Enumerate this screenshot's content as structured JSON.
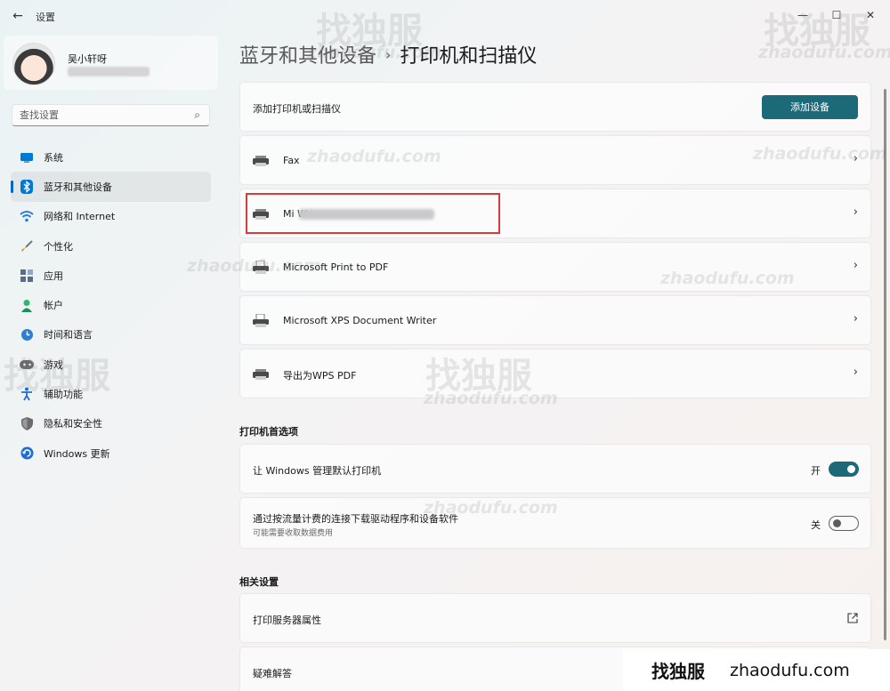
{
  "window": {
    "back_icon": "back-arrow-icon",
    "title": "设置",
    "controls": {
      "minimize": "—",
      "maximize": "☐",
      "close": "✕"
    }
  },
  "user": {
    "name": "吴小轩呀"
  },
  "search": {
    "placeholder": "查找设置",
    "icon": "search-icon"
  },
  "nav": [
    {
      "label": "系统",
      "icon": "monitor-icon",
      "color": "#0078d4"
    },
    {
      "label": "蓝牙和其他设备",
      "icon": "bluetooth-icon",
      "color": "#0078d4",
      "active": true
    },
    {
      "label": "网络和 Internet",
      "icon": "wifi-icon",
      "color": "#2d7dd2"
    },
    {
      "label": "个性化",
      "icon": "brush-icon",
      "color": "#d08a3a"
    },
    {
      "label": "应用",
      "icon": "apps-icon",
      "color": "#5b6c8a"
    },
    {
      "label": "帐户",
      "icon": "person-icon",
      "color": "#2bb673"
    },
    {
      "label": "时间和语言",
      "icon": "globe-clock-icon",
      "color": "#2d7dd2"
    },
    {
      "label": "游戏",
      "icon": "gamepad-icon",
      "color": "#6b6b6b"
    },
    {
      "label": "辅助功能",
      "icon": "accessibility-icon",
      "color": "#1f6fd1"
    },
    {
      "label": "隐私和安全性",
      "icon": "shield-icon",
      "color": "#6b6b6b"
    },
    {
      "label": "Windows 更新",
      "icon": "update-icon",
      "color": "#1f6fd1"
    }
  ],
  "breadcrumb": {
    "parent": "蓝牙和其他设备",
    "separator": "›",
    "current": "打印机和扫描仪"
  },
  "add_printer": {
    "label": "添加打印机或扫描仪",
    "button": "添加设备"
  },
  "devices": [
    {
      "name": "Fax",
      "chevron": "›"
    },
    {
      "name": "Mi W",
      "chevron": "›"
    },
    {
      "name": "Microsoft Print to PDF",
      "chevron": "›"
    },
    {
      "name": "Microsoft XPS Document Writer",
      "chevron": "›"
    },
    {
      "name": "导出为WPS PDF",
      "chevron": "›"
    }
  ],
  "printer_prefs": {
    "title": "打印机首选项",
    "default_mgmt": {
      "label": "让 Windows 管理默认打印机",
      "state": "开",
      "on": true
    },
    "metered": {
      "label": "通过按流量计费的连接下载驱动程序和设备软件",
      "sub": "可能需要收取数据费用",
      "state": "关",
      "on": false
    }
  },
  "related": {
    "title": "相关设置",
    "print_server": {
      "label": "打印服务器属性",
      "icon": "external-link-icon"
    },
    "troubleshoot": {
      "label": "疑难解答"
    }
  },
  "watermark": {
    "cn": "找独服",
    "en": "zhaodufu.com"
  },
  "footer": {
    "cn": "找独服",
    "en": "zhaodufu.com"
  },
  "colors": {
    "accent": "#1c6a79",
    "highlight": "#d83b3b"
  }
}
